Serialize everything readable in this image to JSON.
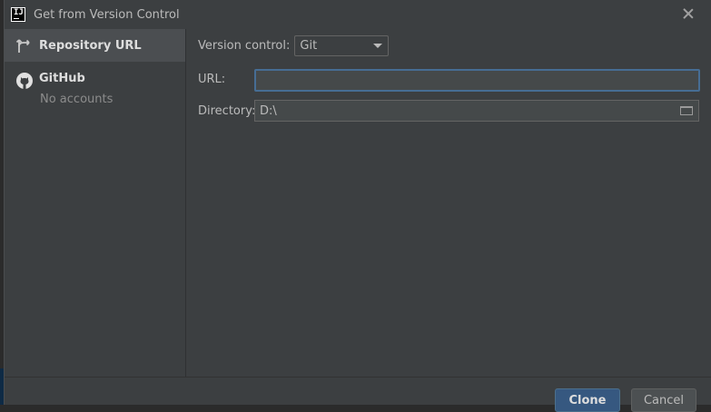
{
  "window": {
    "title": "Get from Version Control"
  },
  "sidebar": {
    "items": [
      {
        "label": "Repository URL",
        "icon": "vcs-branch-icon"
      },
      {
        "label": "GitHub",
        "sublabel": "No accounts",
        "icon": "github-icon"
      }
    ]
  },
  "form": {
    "version_control_label": "Version control:",
    "version_control_value": "Git",
    "url_label": "URL:",
    "url_value": "",
    "directory_label": "Directory:",
    "directory_value": "D:\\"
  },
  "footer": {
    "clone_label": "Clone",
    "cancel_label": "Cancel"
  },
  "colors": {
    "accent": "#365880",
    "focus_border": "#466d94",
    "dialog_bg": "#3c3f41",
    "selected_bg": "#4b4e51"
  }
}
